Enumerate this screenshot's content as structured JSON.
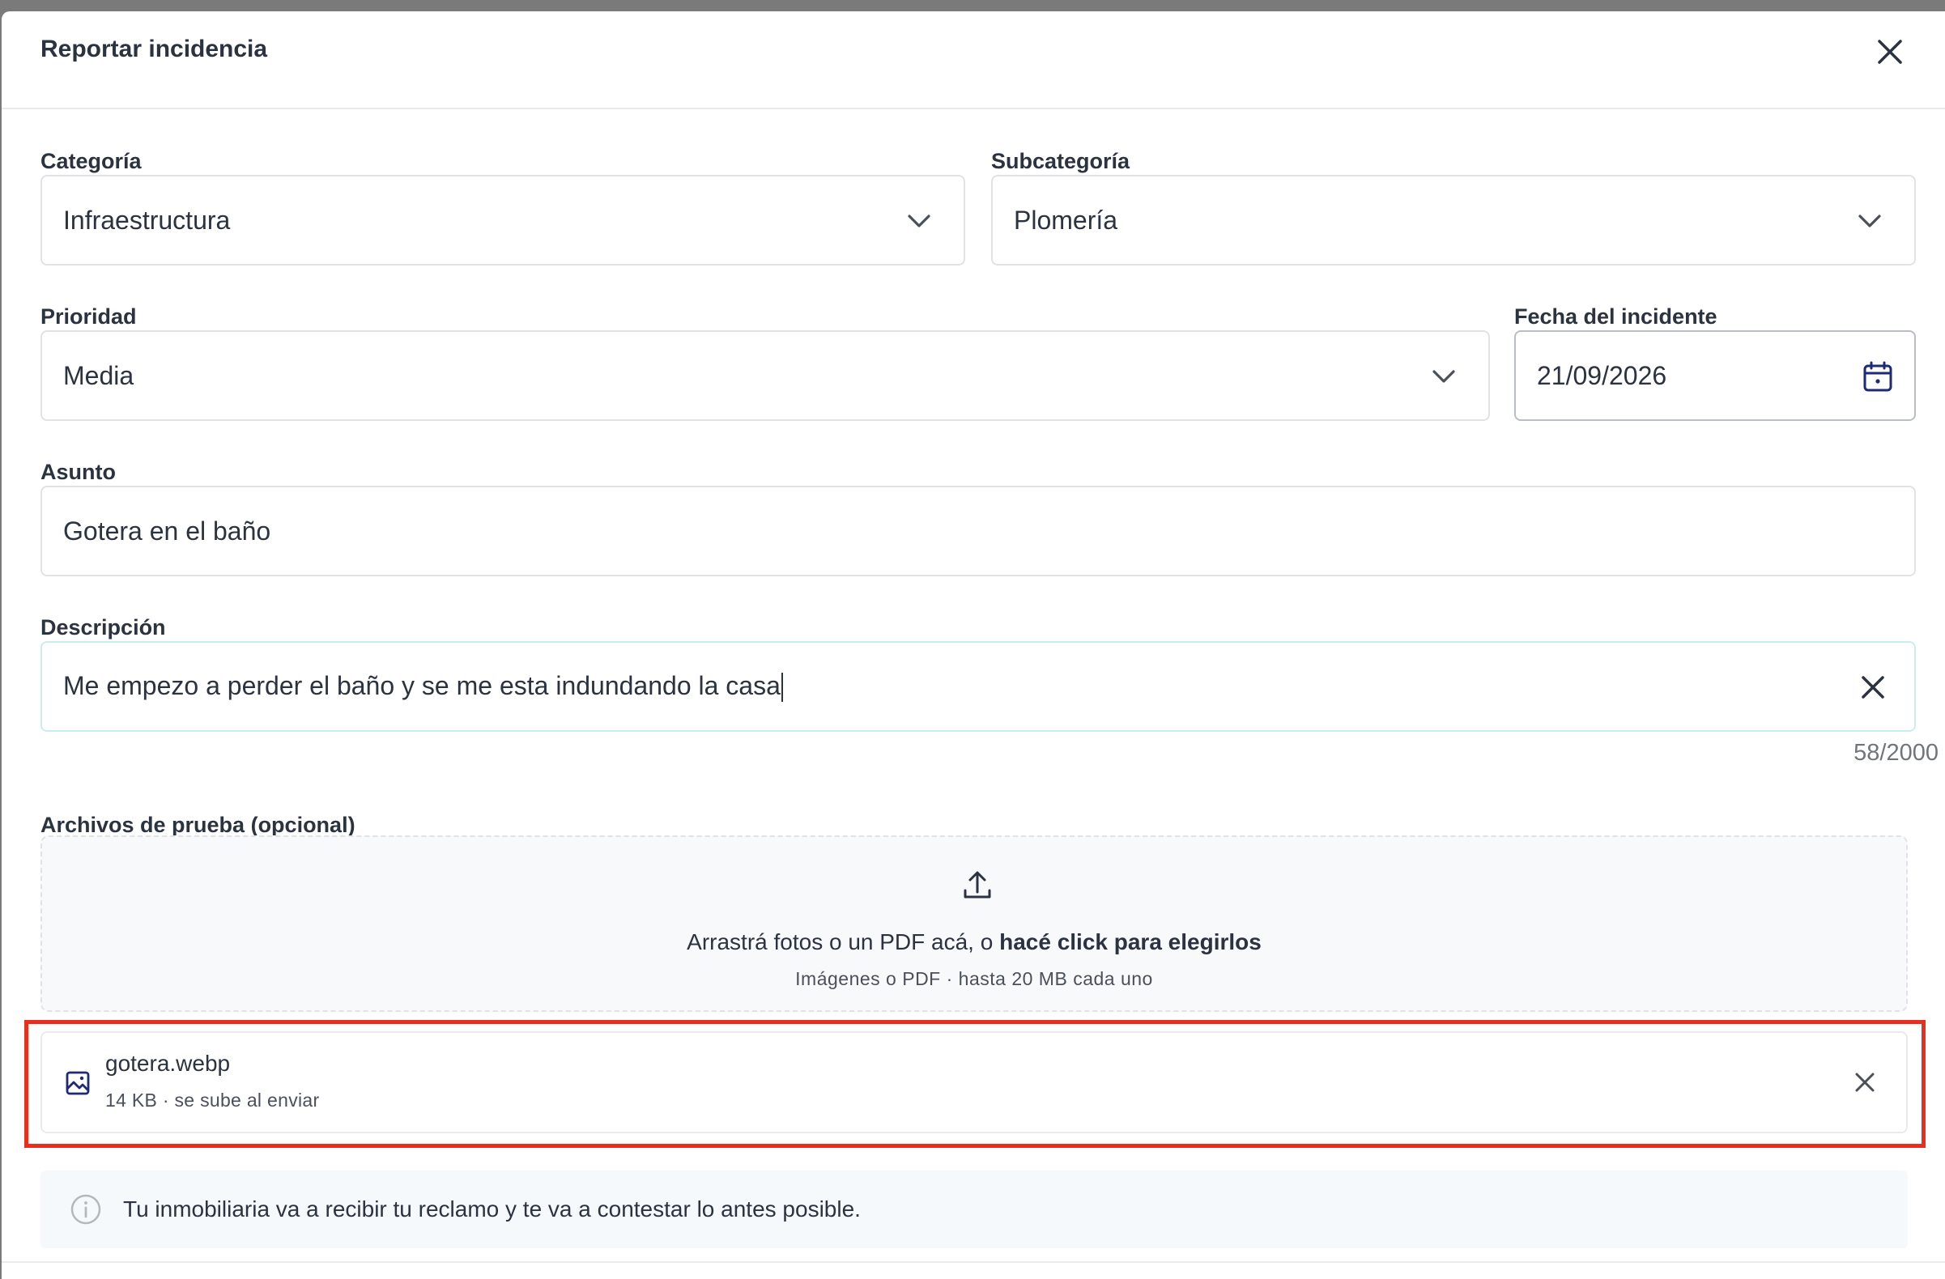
{
  "dialog": {
    "title": "Reportar incidencia"
  },
  "form": {
    "categoria": {
      "label": "Categoría",
      "value": "Infraestructura"
    },
    "subcategoria": {
      "label": "Subcategoría",
      "value": "Plomería"
    },
    "prioridad": {
      "label": "Prioridad",
      "value": "Media"
    },
    "fecha": {
      "label": "Fecha del incidente",
      "value": "21/09/2026"
    },
    "asunto": {
      "label": "Asunto",
      "value": "Gotera en el baño"
    },
    "descripcion": {
      "label": "Descripción",
      "value": "Me empezo a perder el baño y se me esta indundando la casa",
      "counter": "58/2000"
    }
  },
  "attachments": {
    "label": "Archivos de prueba (opcional)",
    "dropzone": {
      "text": "Arrastrá fotos o un PDF acá, o ",
      "link_text": "hacé click para elegirlos",
      "hint": "Imágenes o PDF · hasta 20 MB cada uno"
    },
    "files": [
      {
        "name": "gotera.webp",
        "meta": "14 KB · se sube al enviar",
        "icon": "image-icon"
      }
    ]
  },
  "info": {
    "text": "Tu inmobiliaria va a recibir tu reclamo y te va a contestar lo antes posible."
  },
  "colors": {
    "accent": "#1e2a78",
    "highlight": "#ea2e1d",
    "text": "#2b3240"
  }
}
